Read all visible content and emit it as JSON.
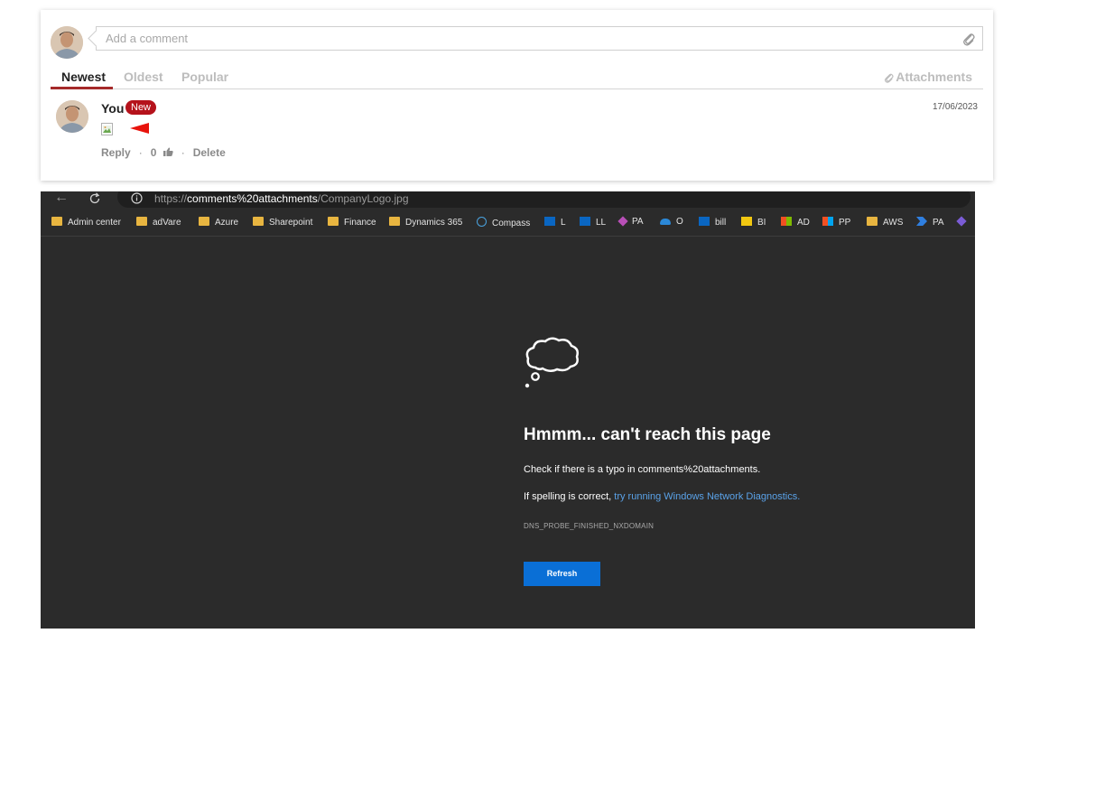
{
  "comments": {
    "input_placeholder": "Add a comment",
    "tabs": [
      {
        "label": "Newest",
        "active": true
      },
      {
        "label": "Oldest",
        "active": false
      },
      {
        "label": "Popular",
        "active": false
      }
    ],
    "attachments_label": "Attachments",
    "items": [
      {
        "author": "You",
        "badge": "New",
        "date": "17/06/2023",
        "reply_label": "Reply",
        "likes": "0",
        "delete_label": "Delete"
      }
    ],
    "colors": {
      "badge": "#b5121b",
      "active_tab_underline": "#a52a2a",
      "pointer_arrow": "#e8130c"
    }
  },
  "browser": {
    "url_prefix": "https://",
    "url_host": "comments%20attachments",
    "url_path": "/CompanyLogo.jpg",
    "favorites": [
      {
        "label": "Admin center",
        "icon": "folder-icon"
      },
      {
        "label": "adVare",
        "icon": "folder-icon"
      },
      {
        "label": "Azure",
        "icon": "folder-icon"
      },
      {
        "label": "Sharepoint",
        "icon": "folder-icon"
      },
      {
        "label": "Finance",
        "icon": "folder-icon"
      },
      {
        "label": "Dynamics 365",
        "icon": "folder-icon"
      },
      {
        "label": "Compass",
        "icon": "compass-icon"
      },
      {
        "label": "L",
        "icon": "linkedin-icon"
      },
      {
        "label": "LL",
        "icon": "learning-icon"
      },
      {
        "label": "PA",
        "icon": "power-apps-icon"
      },
      {
        "label": "O",
        "icon": "onedrive-icon"
      },
      {
        "label": "bill",
        "icon": "linkedin-icon"
      },
      {
        "label": "BI",
        "icon": "power-bi-icon"
      },
      {
        "label": "AD",
        "icon": "microsoft-icon"
      },
      {
        "label": "PP",
        "icon": "microsoft-icon"
      },
      {
        "label": "AWS",
        "icon": "folder-icon"
      },
      {
        "label": "PA",
        "icon": "power-automate-icon"
      },
      {
        "label": "",
        "icon": "gem-icon"
      }
    ],
    "error": {
      "title": "Hmmm... can't reach this page",
      "line1": "Check if there is a typo in comments%20attachments.",
      "line2_prefix": "If spelling is correct,",
      "line2_link": "try running Windows Network Diagnostics.",
      "code": "DNS_PROBE_FINISHED_NXDOMAIN",
      "button": "Refresh"
    },
    "colors": {
      "background": "#2b2b2b",
      "button": "#0a6fd6",
      "link": "#5aa2e8"
    }
  }
}
